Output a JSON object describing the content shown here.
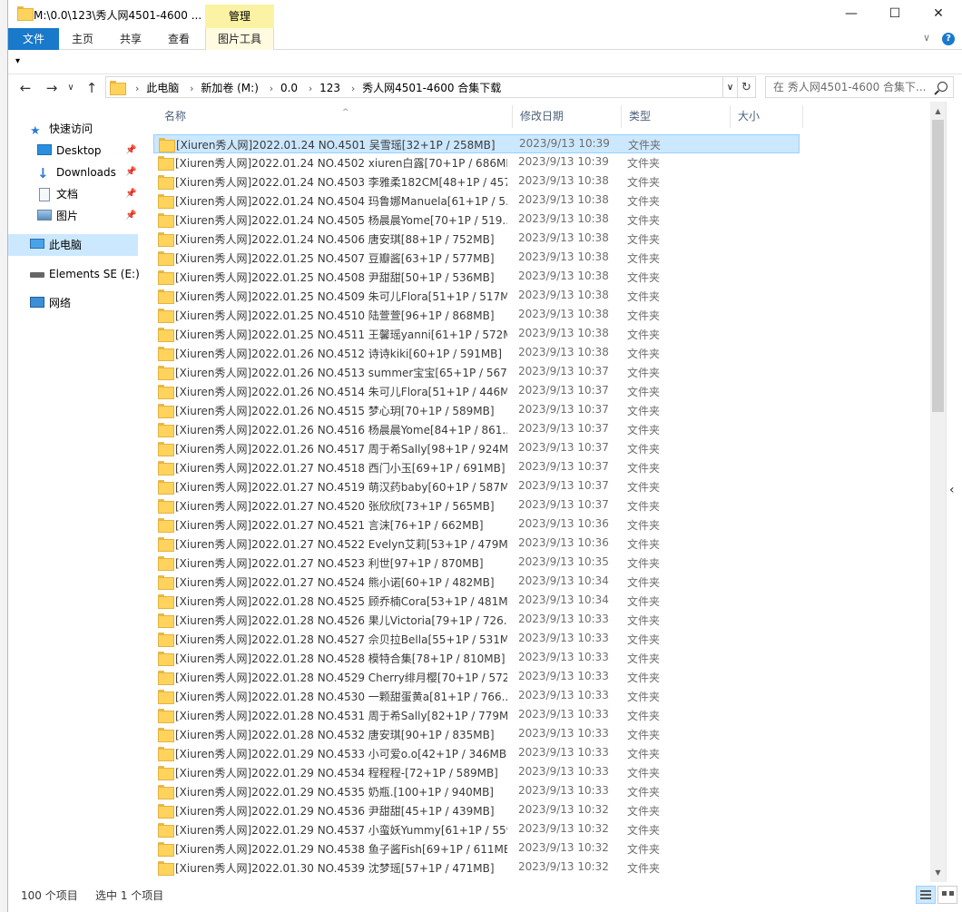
{
  "window": {
    "title": "M:\\0.0\\123\\秀人网4501-4600 ...",
    "manage_tab": "管理",
    "minimize": "—",
    "maximize": "☐",
    "close": "✕"
  },
  "ribbon": {
    "tabs": [
      "文件",
      "主页",
      "共享",
      "查看",
      "图片工具"
    ],
    "expand": "∨",
    "help": "?"
  },
  "qat": {
    "customize": "▾"
  },
  "address": {
    "back": "←",
    "forward": "→",
    "recent": "∨",
    "up": "↑",
    "crumbs": [
      "此电脑",
      "新加卷 (M:)",
      "0.0",
      "123",
      "秀人网4501-4600 合集下载"
    ],
    "crumb_sep": "›",
    "dropdown": "∨",
    "refresh": "↻",
    "search_placeholder": "在 秀人网4501-4600 合集下..."
  },
  "nav": {
    "quick_access": "快速访问",
    "desktop": "Desktop",
    "downloads": "Downloads",
    "documents": "文档",
    "pictures": "图片",
    "this_pc": "此电脑",
    "elements": "Elements SE (E:)",
    "network": "网络",
    "pin": "📌"
  },
  "columns": {
    "name": "名称",
    "date": "修改日期",
    "type": "类型",
    "size": "大小",
    "sort_caret": "^"
  },
  "files": [
    {
      "name": "[Xiuren秀人网]2022.01.24 NO.4501 吴雪瑶[32+1P / 258MB]",
      "date": "2023/9/13 10:39",
      "type": "文件夹"
    },
    {
      "name": "[Xiuren秀人网]2022.01.24 NO.4502 xiuren白露[70+1P / 686MB]",
      "date": "2023/9/13 10:39",
      "type": "文件夹"
    },
    {
      "name": "[Xiuren秀人网]2022.01.24 NO.4503 李雅柔182CM[48+1P / 457...",
      "date": "2023/9/13 10:38",
      "type": "文件夹"
    },
    {
      "name": "[Xiuren秀人网]2022.01.24 NO.4504 玛鲁娜Manuela[61+1P / 5...",
      "date": "2023/9/13 10:38",
      "type": "文件夹"
    },
    {
      "name": "[Xiuren秀人网]2022.01.24 NO.4505 杨晨晨Yome[70+1P / 519...",
      "date": "2023/9/13 10:38",
      "type": "文件夹"
    },
    {
      "name": "[Xiuren秀人网]2022.01.24 NO.4506 唐安琪[88+1P / 752MB]",
      "date": "2023/9/13 10:38",
      "type": "文件夹"
    },
    {
      "name": "[Xiuren秀人网]2022.01.25 NO.4507 豆瓣酱[63+1P / 577MB]",
      "date": "2023/9/13 10:38",
      "type": "文件夹"
    },
    {
      "name": "[Xiuren秀人网]2022.01.25 NO.4508 尹甜甜[50+1P / 536MB]",
      "date": "2023/9/13 10:38",
      "type": "文件夹"
    },
    {
      "name": "[Xiuren秀人网]2022.01.25 NO.4509 朱可儿Flora[51+1P / 517M...",
      "date": "2023/9/13 10:38",
      "type": "文件夹"
    },
    {
      "name": "[Xiuren秀人网]2022.01.25 NO.4510 陆萱萱[96+1P / 868MB]",
      "date": "2023/9/13 10:38",
      "type": "文件夹"
    },
    {
      "name": "[Xiuren秀人网]2022.01.25 NO.4511 王馨瑶yanni[61+1P / 572M...",
      "date": "2023/9/13 10:38",
      "type": "文件夹"
    },
    {
      "name": "[Xiuren秀人网]2022.01.26 NO.4512 诗诗kiki[60+1P / 591MB]",
      "date": "2023/9/13 10:38",
      "type": "文件夹"
    },
    {
      "name": "[Xiuren秀人网]2022.01.26 NO.4513 summer宝宝[65+1P / 567...",
      "date": "2023/9/13 10:37",
      "type": "文件夹"
    },
    {
      "name": "[Xiuren秀人网]2022.01.26 NO.4514 朱可儿Flora[51+1P / 446M...",
      "date": "2023/9/13 10:37",
      "type": "文件夹"
    },
    {
      "name": "[Xiuren秀人网]2022.01.26 NO.4515 梦心玥[70+1P / 589MB]",
      "date": "2023/9/13 10:37",
      "type": "文件夹"
    },
    {
      "name": "[Xiuren秀人网]2022.01.26 NO.4516 杨晨晨Yome[84+1P / 861...",
      "date": "2023/9/13 10:37",
      "type": "文件夹"
    },
    {
      "name": "[Xiuren秀人网]2022.01.26 NO.4517 周于希Sally[98+1P / 924MB]",
      "date": "2023/9/13 10:37",
      "type": "文件夹"
    },
    {
      "name": "[Xiuren秀人网]2022.01.27 NO.4518 西门小玉[69+1P / 691MB]",
      "date": "2023/9/13 10:37",
      "type": "文件夹"
    },
    {
      "name": "[Xiuren秀人网]2022.01.27 NO.4519 萌汉药baby[60+1P / 587M...",
      "date": "2023/9/13 10:37",
      "type": "文件夹"
    },
    {
      "name": "[Xiuren秀人网]2022.01.27 NO.4520 张欣欣[73+1P / 565MB]",
      "date": "2023/9/13 10:37",
      "type": "文件夹"
    },
    {
      "name": "[Xiuren秀人网]2022.01.27 NO.4521 言沫[76+1P / 662MB]",
      "date": "2023/9/13 10:36",
      "type": "文件夹"
    },
    {
      "name": "[Xiuren秀人网]2022.01.27 NO.4522 Evelyn艾莉[53+1P / 479MB]",
      "date": "2023/9/13 10:36",
      "type": "文件夹"
    },
    {
      "name": "[Xiuren秀人网]2022.01.27 NO.4523 利世[97+1P / 870MB]",
      "date": "2023/9/13 10:35",
      "type": "文件夹"
    },
    {
      "name": "[Xiuren秀人网]2022.01.27 NO.4524 熊小诺[60+1P / 482MB]",
      "date": "2023/9/13 10:34",
      "type": "文件夹"
    },
    {
      "name": "[Xiuren秀人网]2022.01.28 NO.4525 顾乔楠Cora[53+1P / 481M...",
      "date": "2023/9/13 10:34",
      "type": "文件夹"
    },
    {
      "name": "[Xiuren秀人网]2022.01.28 NO.4526 果儿Victoria[79+1P / 726...",
      "date": "2023/9/13 10:33",
      "type": "文件夹"
    },
    {
      "name": "[Xiuren秀人网]2022.01.28 NO.4527 佘贝拉Bella[55+1P / 531M...",
      "date": "2023/9/13 10:33",
      "type": "文件夹"
    },
    {
      "name": "[Xiuren秀人网]2022.01.28 NO.4528 模特合集[78+1P / 810MB]",
      "date": "2023/9/13 10:33",
      "type": "文件夹"
    },
    {
      "name": "[Xiuren秀人网]2022.01.28 NO.4529 Cherry绯月樱[70+1P / 572...",
      "date": "2023/9/13 10:33",
      "type": "文件夹"
    },
    {
      "name": "[Xiuren秀人网]2022.01.28 NO.4530 一颗甜蛋黄a[81+1P / 766...",
      "date": "2023/9/13 10:33",
      "type": "文件夹"
    },
    {
      "name": "[Xiuren秀人网]2022.01.28 NO.4531 周于希Sally[82+1P / 779MB]",
      "date": "2023/9/13 10:33",
      "type": "文件夹"
    },
    {
      "name": "[Xiuren秀人网]2022.01.28 NO.4532 唐安琪[90+1P / 835MB]",
      "date": "2023/9/13 10:33",
      "type": "文件夹"
    },
    {
      "name": "[Xiuren秀人网]2022.01.29 NO.4533 小可爱o.o[42+1P / 346MB]",
      "date": "2023/9/13 10:33",
      "type": "文件夹"
    },
    {
      "name": "[Xiuren秀人网]2022.01.29 NO.4534 程程程-[72+1P / 589MB]",
      "date": "2023/9/13 10:33",
      "type": "文件夹"
    },
    {
      "name": "[Xiuren秀人网]2022.01.29 NO.4535 奶瓶.[100+1P / 940MB]",
      "date": "2023/9/13 10:33",
      "type": "文件夹"
    },
    {
      "name": "[Xiuren秀人网]2022.01.29 NO.4536 尹甜甜[45+1P / 439MB]",
      "date": "2023/9/13 10:32",
      "type": "文件夹"
    },
    {
      "name": "[Xiuren秀人网]2022.01.29 NO.4537 小蛮妖Yummy[61+1P / 559...",
      "date": "2023/9/13 10:32",
      "type": "文件夹"
    },
    {
      "name": "[Xiuren秀人网]2022.01.29 NO.4538 鱼子酱Fish[69+1P / 611MB]",
      "date": "2023/9/13 10:32",
      "type": "文件夹"
    },
    {
      "name": "[Xiuren秀人网]2022.01.30 NO.4539 沈梦瑶[57+1P / 471MB]",
      "date": "2023/9/13 10:32",
      "type": "文件夹"
    }
  ],
  "scrollbar": {
    "up": "▲",
    "down": "▼"
  },
  "preview_toggle": "‹",
  "status": {
    "count": "100 个项目",
    "selected": "选中 1 个项目"
  }
}
